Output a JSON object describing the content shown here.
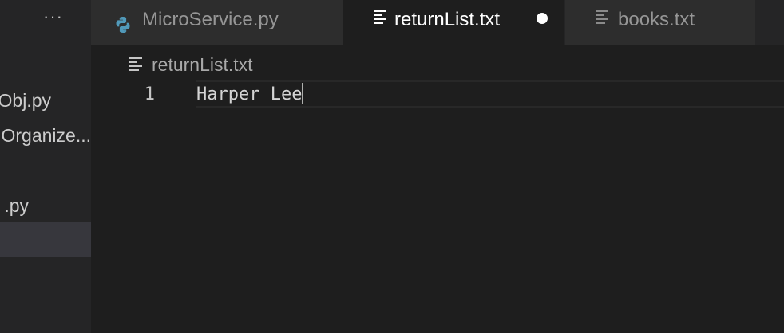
{
  "sidebar": {
    "more_label": "···",
    "items": [
      {
        "label": "Obj.py"
      },
      {
        "label": "Organize..."
      },
      {
        "label": ".py"
      }
    ]
  },
  "tabs": [
    {
      "label": "MicroService.py",
      "icon": "python-icon",
      "active": false
    },
    {
      "label": "returnList.txt",
      "icon": "text-file-icon",
      "active": true,
      "dirty": true
    },
    {
      "label": "books.txt",
      "icon": "text-file-icon",
      "active": false
    }
  ],
  "breadcrumb": {
    "file": "returnList.txt",
    "icon": "text-file-icon"
  },
  "editor": {
    "lines": [
      {
        "number": "1",
        "text": "Harper Lee"
      }
    ]
  },
  "colors": {
    "editor_bg": "#1e1e1e",
    "sidebar_bg": "#252526",
    "tab_inactive_bg": "#2d2d2d",
    "python_blue": "#519aba"
  }
}
